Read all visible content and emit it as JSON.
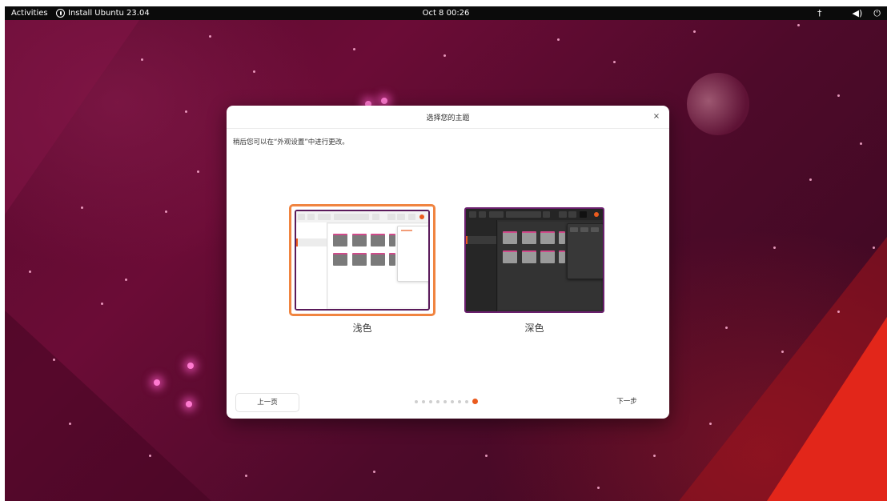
{
  "topbar": {
    "activities": "Activities",
    "app_menu": "Install Ubuntu 23.04",
    "clock": "Oct 8  00:26",
    "tray_icons": [
      "accessibility-icon",
      "volume-icon",
      "power-icon"
    ]
  },
  "dialog": {
    "title": "选择您的主题",
    "close_icon": "×",
    "subtitle": "稍后您可以在“外观设置”中进行更改。",
    "themes": [
      {
        "label": "浅色",
        "selected": true
      },
      {
        "label": "深色",
        "selected": false
      }
    ],
    "back_label": "上一页",
    "next_label": "下一步",
    "pager": {
      "total": 9,
      "current": 9
    }
  },
  "colors": {
    "accent": "#ea5b1e",
    "selected_border": "#f08440",
    "topbar": "#0b0b0b",
    "wallpaper": "#5a0a2e"
  }
}
